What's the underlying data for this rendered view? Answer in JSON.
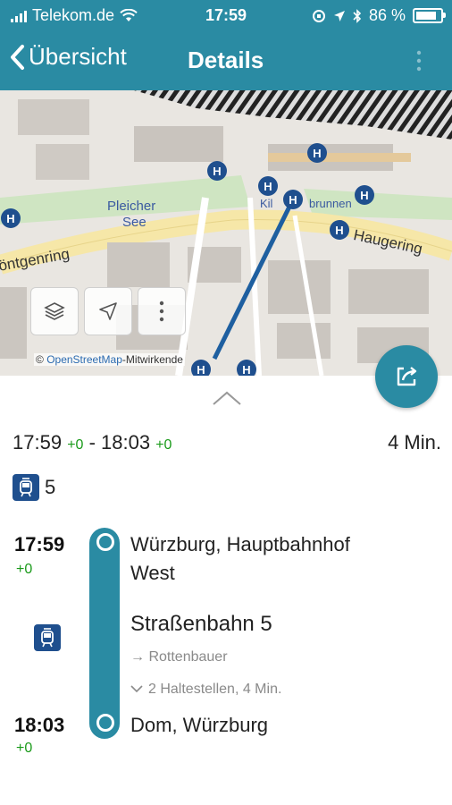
{
  "status": {
    "carrier": "Telekom.de",
    "time": "17:59",
    "battery": "86 %",
    "battery_level": 0.86
  },
  "nav": {
    "back_label": "Übersicht",
    "title": "Details"
  },
  "map": {
    "labels": [
      "Pleicher",
      "See",
      "Haugering",
      "öntgenring",
      "Kil",
      "brunnen"
    ],
    "attribution_link": "OpenStreetMap",
    "attribution_rest": "-Mitwirkende"
  },
  "summary": {
    "dep": "17:59",
    "dep_delay": "+0",
    "sep": "-",
    "arr": "18:03",
    "arr_delay": "+0",
    "duration": "4  Min."
  },
  "line_badge": "5",
  "timeline": {
    "start_time": "17:59",
    "start_delay": "+0",
    "start_stop_1": "Würzburg, Hauptbahnhof",
    "start_stop_2": "West",
    "line_name": "Straßenbahn 5",
    "direction": "Rottenbauer",
    "stops_info": "2 Haltestellen, 4  Min.",
    "end_time": "18:03",
    "end_delay": "+0",
    "end_stop": "Dom, Würzburg"
  },
  "colors": {
    "accent": "#2a8ba3",
    "tram": "#1f4f8e",
    "delay": "#1a9a1a"
  }
}
